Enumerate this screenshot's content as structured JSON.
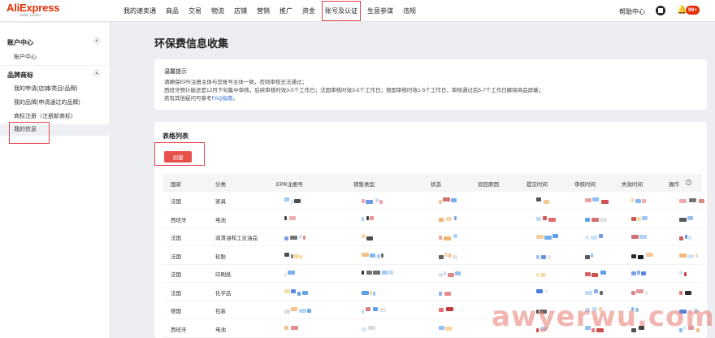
{
  "logo": {
    "brand": "AliExpress",
    "sub": "Seller Center"
  },
  "nav": [
    "我的速卖通",
    "商品",
    "交易",
    "物流",
    "店铺",
    "营销",
    "推广",
    "资金",
    "账号及认证",
    "生意参谋",
    "违规"
  ],
  "header": {
    "help": "帮助中心",
    "badge": "99+"
  },
  "sidebar": {
    "group1": "账户中心",
    "group1_items": [
      "账户中心"
    ],
    "group2": "品牌商标",
    "group2_items": [
      "我的申请(店铺/类目/品牌)",
      "我的品牌(申请通过的品牌)",
      "商标注册（注册新商标）",
      "我的信息"
    ]
  },
  "page": {
    "title": "环保费信息收集",
    "tips": {
      "title": "温馨提示",
      "line1": "请确保EPR注册主体与您账号主体一致，否则审核无法通过；",
      "line2": "西班牙预计能还是12月下旬集中审核，后续审核时效3-5个工作日；法国审核时效3-5个工作日；德国审核时效1-5个工作日，审核通过后5-7个工作日解除商品屏蔽；",
      "line3_pre": "若有其他疑问可参考",
      "line3_link": "FAQ指南",
      "line3_post": "。"
    },
    "table_title": "表格列表",
    "create_button": "创建",
    "columns": [
      "国家",
      "分类",
      "EPR注册号",
      "销售类型",
      "状态",
      "驳回原因",
      "提交时间",
      "审核时间",
      "失效时间",
      "操作"
    ],
    "rows": [
      {
        "country": "法国",
        "category": "家具"
      },
      {
        "country": "西班牙",
        "category": "电池"
      },
      {
        "country": "法国",
        "category": "润滑油和工业油品"
      },
      {
        "country": "法国",
        "category": "轮胎"
      },
      {
        "country": "法国",
        "category": "印刷纸"
      },
      {
        "country": "法国",
        "category": "化学品"
      },
      {
        "country": "德国",
        "category": "包装"
      },
      {
        "country": "西班牙",
        "category": "电池"
      }
    ]
  },
  "watermark": "awyerwu.com",
  "colors": {
    "accent": "#e62e04",
    "highlight": "#e8424a",
    "button": "#e8504a",
    "link": "#2f72d8"
  }
}
